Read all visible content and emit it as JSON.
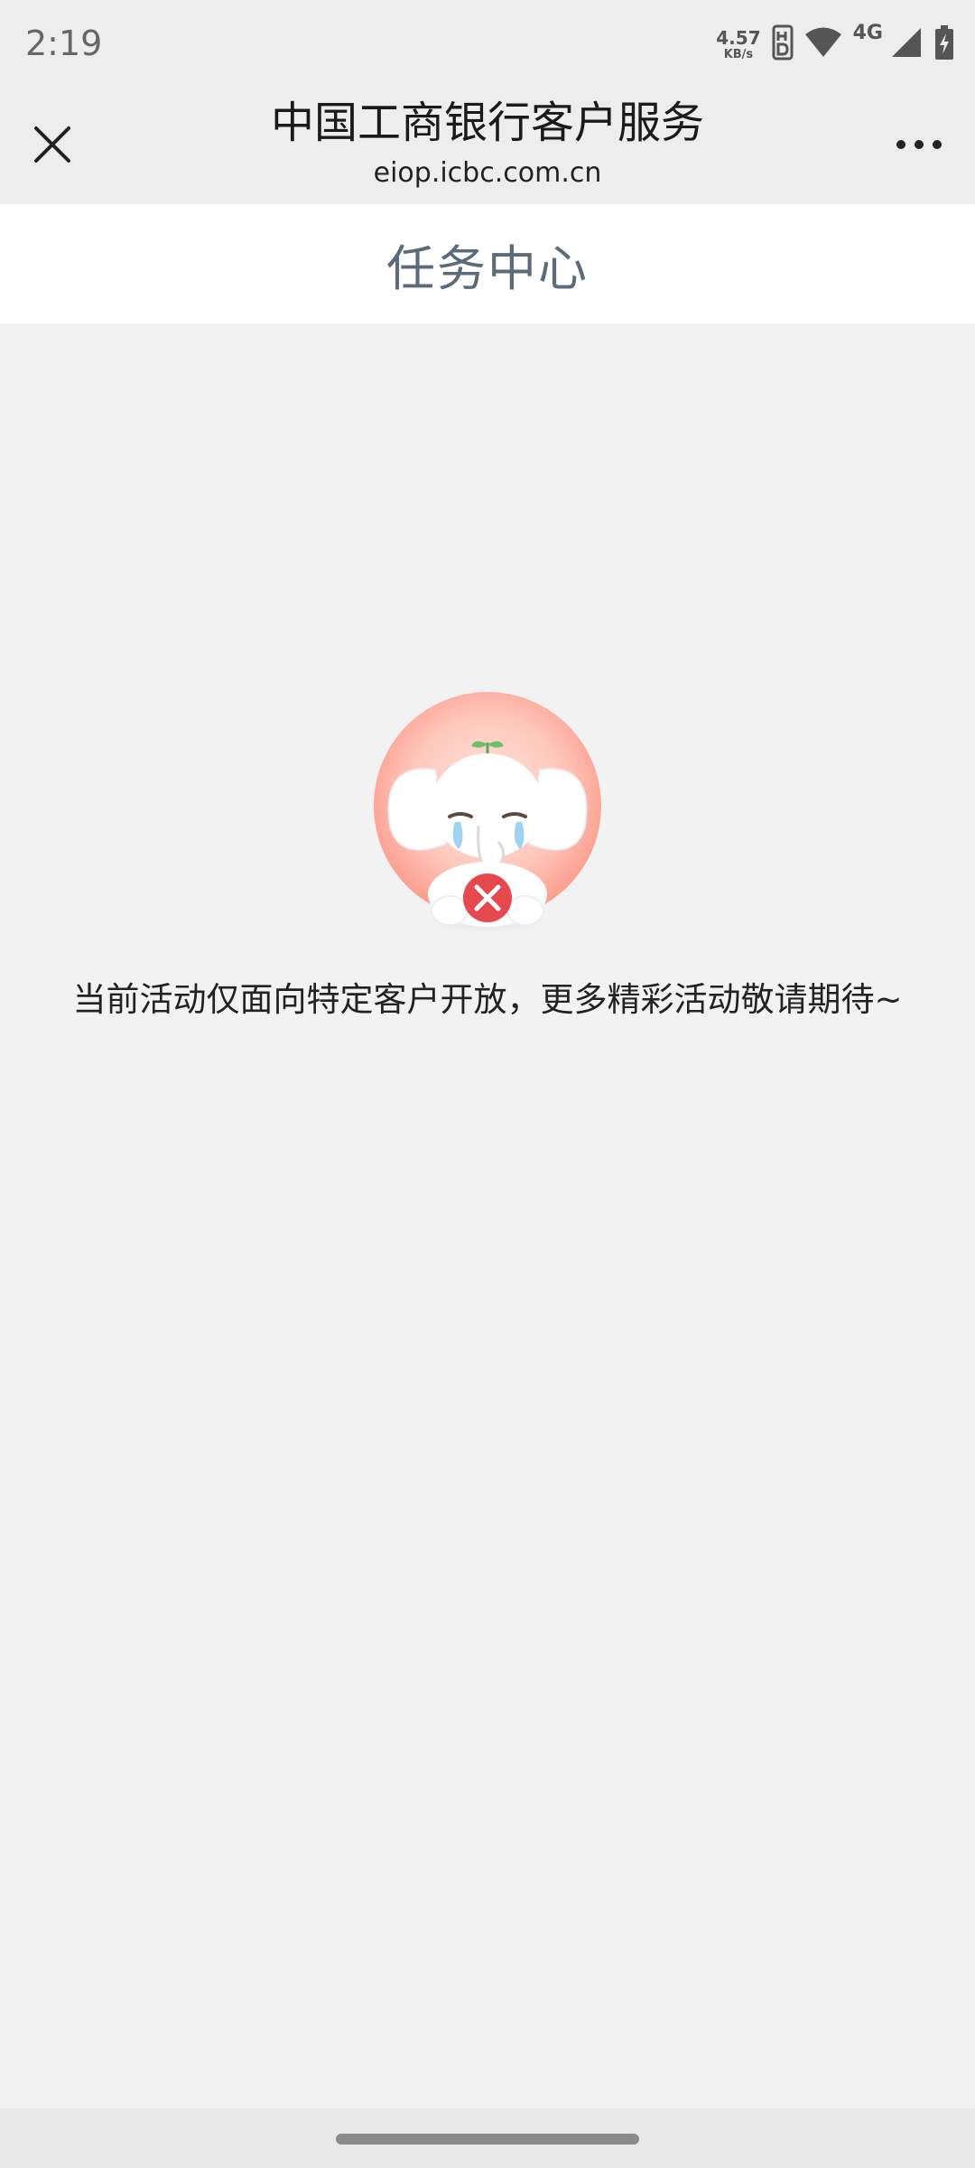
{
  "status_bar": {
    "time": "2:19",
    "net_speed_value": "4.57",
    "net_speed_unit": "KB/s",
    "network_type": "4G",
    "icons": [
      "hd-icon",
      "wifi-icon",
      "cellular-signal-icon",
      "battery-charging-icon"
    ]
  },
  "webview": {
    "title": "中国工商银行客户服务",
    "url": "eiop.icbc.com.cn",
    "close_icon": "close-icon",
    "more_icon": "more-icon"
  },
  "page": {
    "title": "任务中心",
    "empty_message": "当前活动仅面向特定客户开放，更多精彩活动敬请期待~",
    "illustration": "crying-elephant-mascot"
  },
  "colors": {
    "page_background": "#f2f2f2",
    "header_background": "#ffffff",
    "title_text": "#5c6b7a",
    "error_badge": "#e5484d"
  }
}
